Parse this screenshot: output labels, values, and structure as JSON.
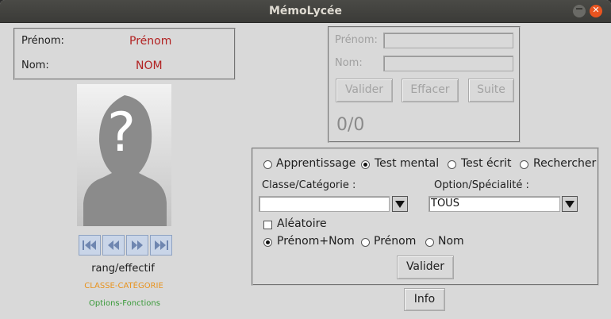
{
  "window": {
    "title": "MémoLycée"
  },
  "id_box": {
    "prenom_label": "Prénom:",
    "prenom_value": "Prénom",
    "nom_label": "Nom:",
    "nom_value": "NOM"
  },
  "photo": {
    "symbol": "?"
  },
  "nav": {
    "first": "first-icon",
    "prev": "previous-icon",
    "next": "next-icon",
    "last": "last-icon"
  },
  "info_left": {
    "rank": "rang/effectif",
    "classe": "CLASSE-CATÉGORIE",
    "options": "Options-Fonctions"
  },
  "colors": {
    "classe": "#e8931e",
    "options": "#3a9a3a",
    "names": "#b22222"
  },
  "test_box": {
    "prenom_label": "Prénom:",
    "nom_label": "Nom:",
    "prenom_value": "",
    "nom_value": "",
    "valider": "Valider",
    "effacer": "Effacer",
    "suite": "Suite",
    "score": "0/0"
  },
  "settings": {
    "modes": [
      "Apprentissage",
      "Test mental",
      "Test écrit",
      "Rechercher"
    ],
    "selected_mode": "Test mental",
    "classe_label": "Classe/Catégorie :",
    "classe_value": "",
    "option_label": "Option/Spécialité :",
    "option_value": "TOUS",
    "aleatoire": "Aléatoire",
    "name_modes": [
      "Prénom+Nom",
      "Prénom",
      "Nom"
    ],
    "selected_name_mode": "Prénom+Nom",
    "valider": "Valider"
  },
  "info_button": "Info"
}
